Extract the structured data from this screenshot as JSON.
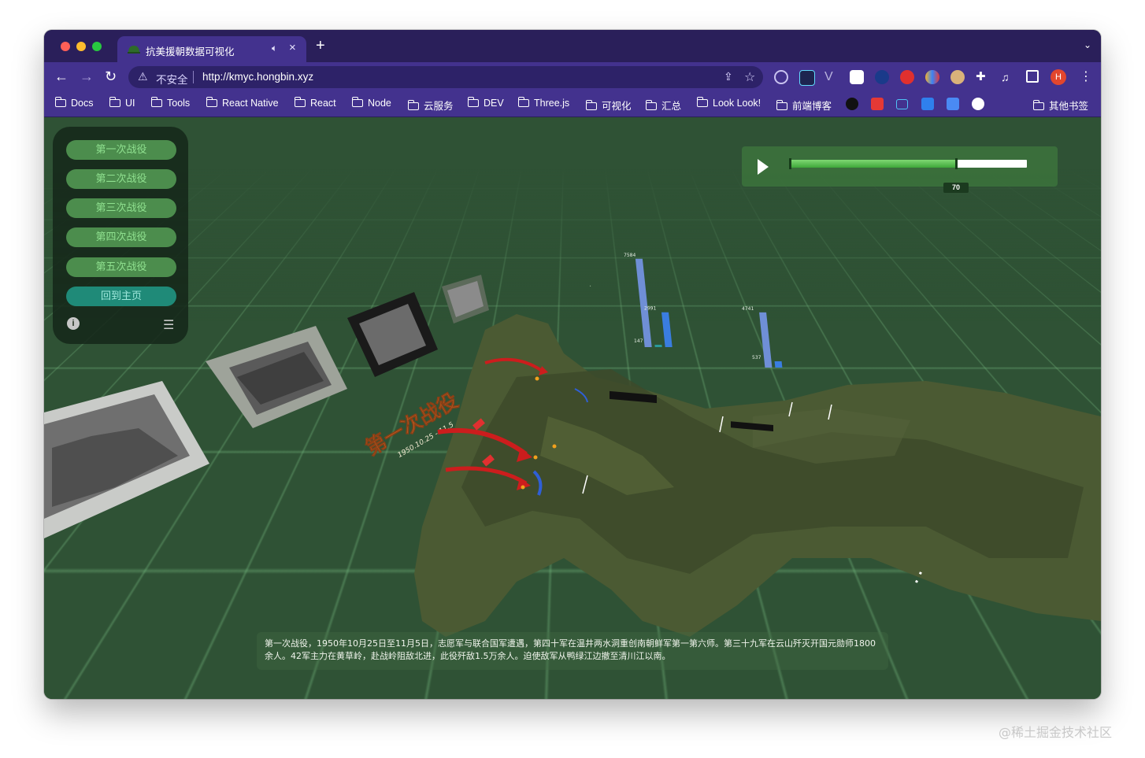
{
  "tab": {
    "title": "抗美援朝数据可视化"
  },
  "omnibox": {
    "security_label": "不安全",
    "url": "http://kmyc.hongbin.xyz"
  },
  "bookmarks": [
    {
      "label": "Docs"
    },
    {
      "label": "UI"
    },
    {
      "label": "Tools"
    },
    {
      "label": "React Native"
    },
    {
      "label": "React"
    },
    {
      "label": "Node"
    },
    {
      "label": "云服务"
    },
    {
      "label": "DEV"
    },
    {
      "label": "Three.js"
    },
    {
      "label": "可视化"
    },
    {
      "label": "汇总"
    },
    {
      "label": "Look Look!"
    },
    {
      "label": "前端博客"
    }
  ],
  "bookmarks_other": "其他书签",
  "profile_initial": "H",
  "sidebar": {
    "buttons": [
      "第一次战役",
      "第二次战役",
      "第三次战役",
      "第四次战役",
      "第五次战役"
    ],
    "home": "回到主页"
  },
  "timeline": {
    "value": 70,
    "max": 100
  },
  "scene": {
    "battle_title": "第一次战役",
    "battle_dates": "1950.10.25 - 11.5",
    "bar_groups": [
      {
        "values": [
          7584,
          147,
          2991
        ]
      },
      {
        "values": [
          4741,
          537
        ]
      }
    ]
  },
  "description": "第一次战役，1950年10月25日至11月5日，志愿军与联合国军遭遇，第四十军在温井两水洞重创南朝鲜军第一第六师。第三十九军在云山歼灭开国元勋师1800余人。42军主力在黄草岭，赴战岭阻敌北进，此役歼敌1.5万余人。迫使敌军从鸭绿江边撤至清川江以南。",
  "watermark": "@稀土掘金技术社区",
  "colors": {
    "tab_bar": "#2a1f5a",
    "toolbar": "#43328e",
    "ground": "#2f5235",
    "button": "#4c8d4d",
    "home_button": "#1f8a78"
  }
}
